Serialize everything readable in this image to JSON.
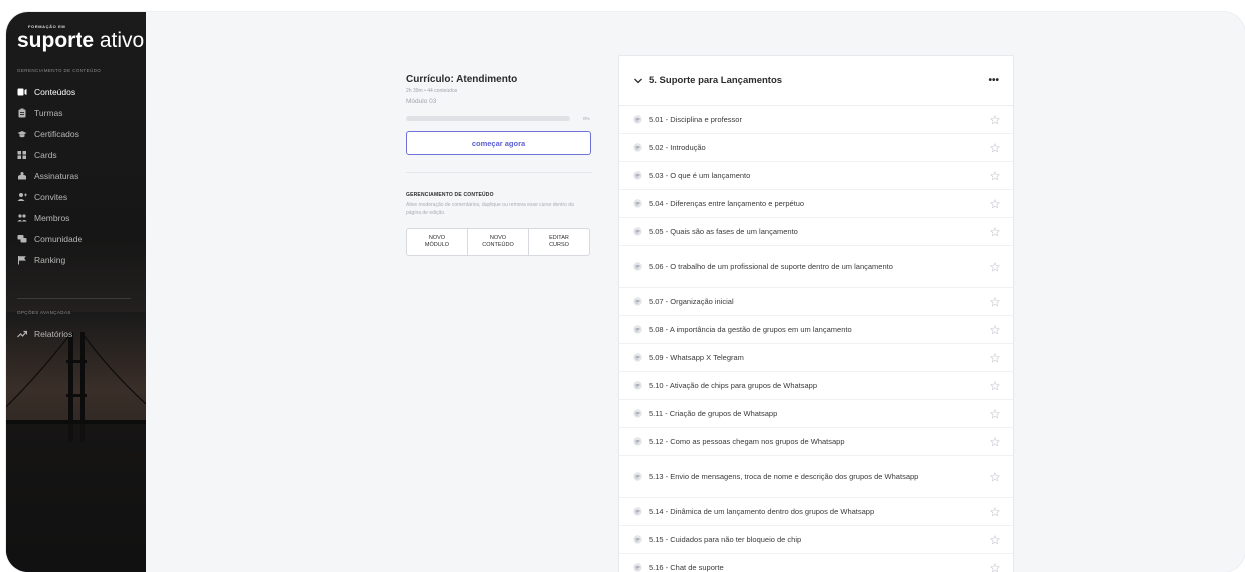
{
  "brand": {
    "small": "FORMAÇÃO EM",
    "bold": "suporte",
    "light": "ativo"
  },
  "sidebar": {
    "section_main": "GERENCIAMENTO DE CONTEÚDO",
    "items": [
      {
        "label": "Conteúdos",
        "icon": "content-icon",
        "active": true
      },
      {
        "label": "Turmas",
        "icon": "clipboard-icon",
        "active": false
      },
      {
        "label": "Certificados",
        "icon": "graduation-cap-icon",
        "active": false
      },
      {
        "label": "Cards",
        "icon": "grid-icon",
        "active": false
      },
      {
        "label": "Assinaturas",
        "icon": "subscription-icon",
        "active": false
      },
      {
        "label": "Convites",
        "icon": "user-plus-icon",
        "active": false
      },
      {
        "label": "Membros",
        "icon": "members-icon",
        "active": false
      },
      {
        "label": "Comunidade",
        "icon": "chat-bubbles-icon",
        "active": false
      },
      {
        "label": "Ranking",
        "icon": "flag-icon",
        "active": false
      }
    ],
    "section_advanced": "OPÇÕES AVANÇADAS",
    "advanced_items": [
      {
        "label": "Relatórios",
        "icon": "trend-up-icon"
      }
    ]
  },
  "curriculum": {
    "title": "Currículo: Atendimento",
    "meta": "2h 39m • 44 conteúdos",
    "module": "Módulo 03",
    "progress": 0,
    "progress_label": "0%",
    "start_button": "começar agora",
    "manage_title": "GERENCIAMENTO DE CONTEÚDO",
    "manage_desc": "Ative moderação de comentários, duplique ou remova esse curso dentro da página de edição.",
    "buttons": {
      "new_module": "NOVO\nMÓDULO",
      "new_content": "NOVO\nCONTEÚDO",
      "edit_course": "EDITAR\nCURSO"
    }
  },
  "module": {
    "title": "5. Suporte para Lançamentos",
    "more": "•••",
    "lessons": [
      "5.01 - Disciplina e professor",
      "5.02 - Introdução",
      "5.03 - O que é um lançamento",
      "5.04 - Diferenças entre lançamento e perpétuo",
      "5.05 - Quais são as fases de um lançamento",
      "5.06 - O trabalho de um profissional de suporte dentro de um lançamento",
      "5.07 - Organização inicial",
      "5.08 - A importância da gestão de grupos em um lançamento",
      "5.09 - Whatsapp X Telegram",
      "5.10 - Ativação de chips para grupos de Whatsapp",
      "5.11 - Criação de grupos de Whatsapp",
      "5.12 - Como as pessoas chegam nos grupos de Whatsapp",
      "5.13 - Envio de mensagens, troca de nome e descrição dos grupos de Whatsapp",
      "5.14 - Dinâmica de um lançamento dentro dos grupos de Whatsapp",
      "5.15 - Cuidados para não ter bloqueio de chip",
      "5.16 - Chat de suporte"
    ]
  },
  "colors": {
    "accent": "#5a5fd4",
    "sidebar_bg": "#161616"
  }
}
